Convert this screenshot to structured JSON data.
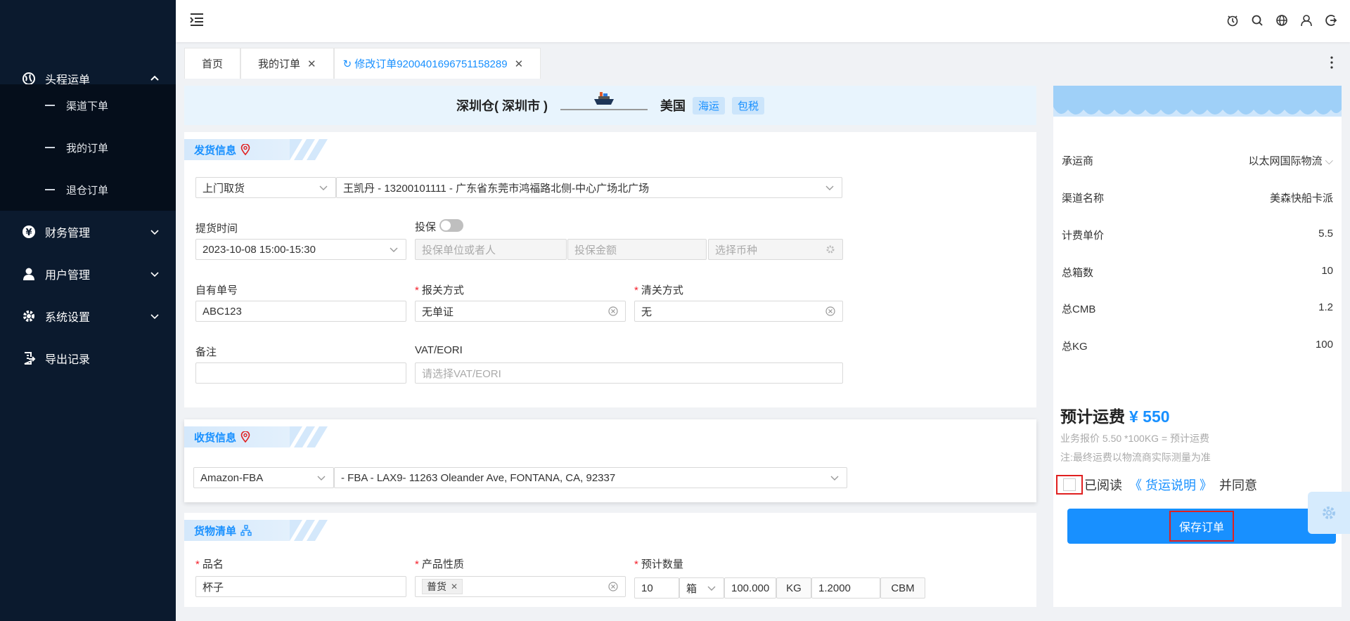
{
  "sidebar": {
    "menu": [
      {
        "label": "头程运单",
        "icon": "globe-icon",
        "expanded": true
      },
      {
        "label": "财务管理",
        "icon": "yen-icon"
      },
      {
        "label": "用户管理",
        "icon": "user-icon"
      },
      {
        "label": "系统设置",
        "icon": "gear-icon"
      },
      {
        "label": "导出记录",
        "icon": "export-icon"
      }
    ],
    "submenu": [
      "渠道下单",
      "我的订单",
      "退仓订单"
    ]
  },
  "tabs": [
    {
      "label": "首页",
      "closable": false
    },
    {
      "label": "我的订单",
      "closable": true
    },
    {
      "label": "修改订单9200401696751158289",
      "closable": true,
      "active": true
    }
  ],
  "route": {
    "from": "深圳仓( 深圳市 )",
    "to": "美国",
    "tags": [
      "海运",
      "包税"
    ]
  },
  "shipping": {
    "title": "发货信息",
    "pickup_method": "上门取货",
    "address": "王凯丹 - 13200101111 - 广东省东莞市鸿福路北侧-中心广场北广场",
    "pickup_time_label": "提货时间",
    "pickup_time": "2023-10-08 15:00-15:30",
    "insure_label": "投保",
    "insure_holder_placeholder": "投保单位或者人",
    "insure_amount_placeholder": "投保金额",
    "currency_placeholder": "选择币种",
    "own_no_label": "自有单号",
    "own_no": "ABC123",
    "customs_label": "报关方式",
    "customs_value": "无单证",
    "clearance_label": "清关方式",
    "clearance_value": "无",
    "remark_label": "备注",
    "remark_value": "",
    "vat_label": "VAT/EORI",
    "vat_placeholder": "请选择VAT/EORI"
  },
  "receiving": {
    "title": "收货信息",
    "type": "Amazon-FBA",
    "address": "- FBA - LAX9- 11263 Oleander Ave, FONTANA, CA, 92337"
  },
  "cargo": {
    "title": "货物清单",
    "name_label": "品名",
    "name_value": "杯子",
    "nature_label": "产品性质",
    "nature_chip": "普货",
    "qty_label": "预计数量",
    "qty": "10",
    "qty_unit": "箱",
    "weight": "100.000",
    "weight_unit": "KG",
    "volume": "1.2000",
    "volume_unit": "CBM"
  },
  "summary": {
    "rows": [
      {
        "label": "承运商",
        "value": "以太网国际物流"
      },
      {
        "label": "渠道名称",
        "value": "美森快船卡派"
      },
      {
        "label": "计费单价",
        "value": "5.5"
      },
      {
        "label": "总箱数",
        "value": "10"
      },
      {
        "label": "总CMB",
        "value": "1.2"
      },
      {
        "label": "总KG",
        "value": "100"
      }
    ],
    "estimate_label": "预计运费",
    "estimate_amount": "¥ 550",
    "note1": "业务报价 5.50 *100KG = 预计运费",
    "note2": "注:最终运费以物流商实际测量为准",
    "agree_pre": "已阅读",
    "agree_link": "《 货运说明 》",
    "agree_post": "并同意",
    "save_label": "保存订单"
  },
  "colors": {
    "primary": "#1890ff",
    "sidebar": "#0b1a2e",
    "required": "#f5222d"
  }
}
